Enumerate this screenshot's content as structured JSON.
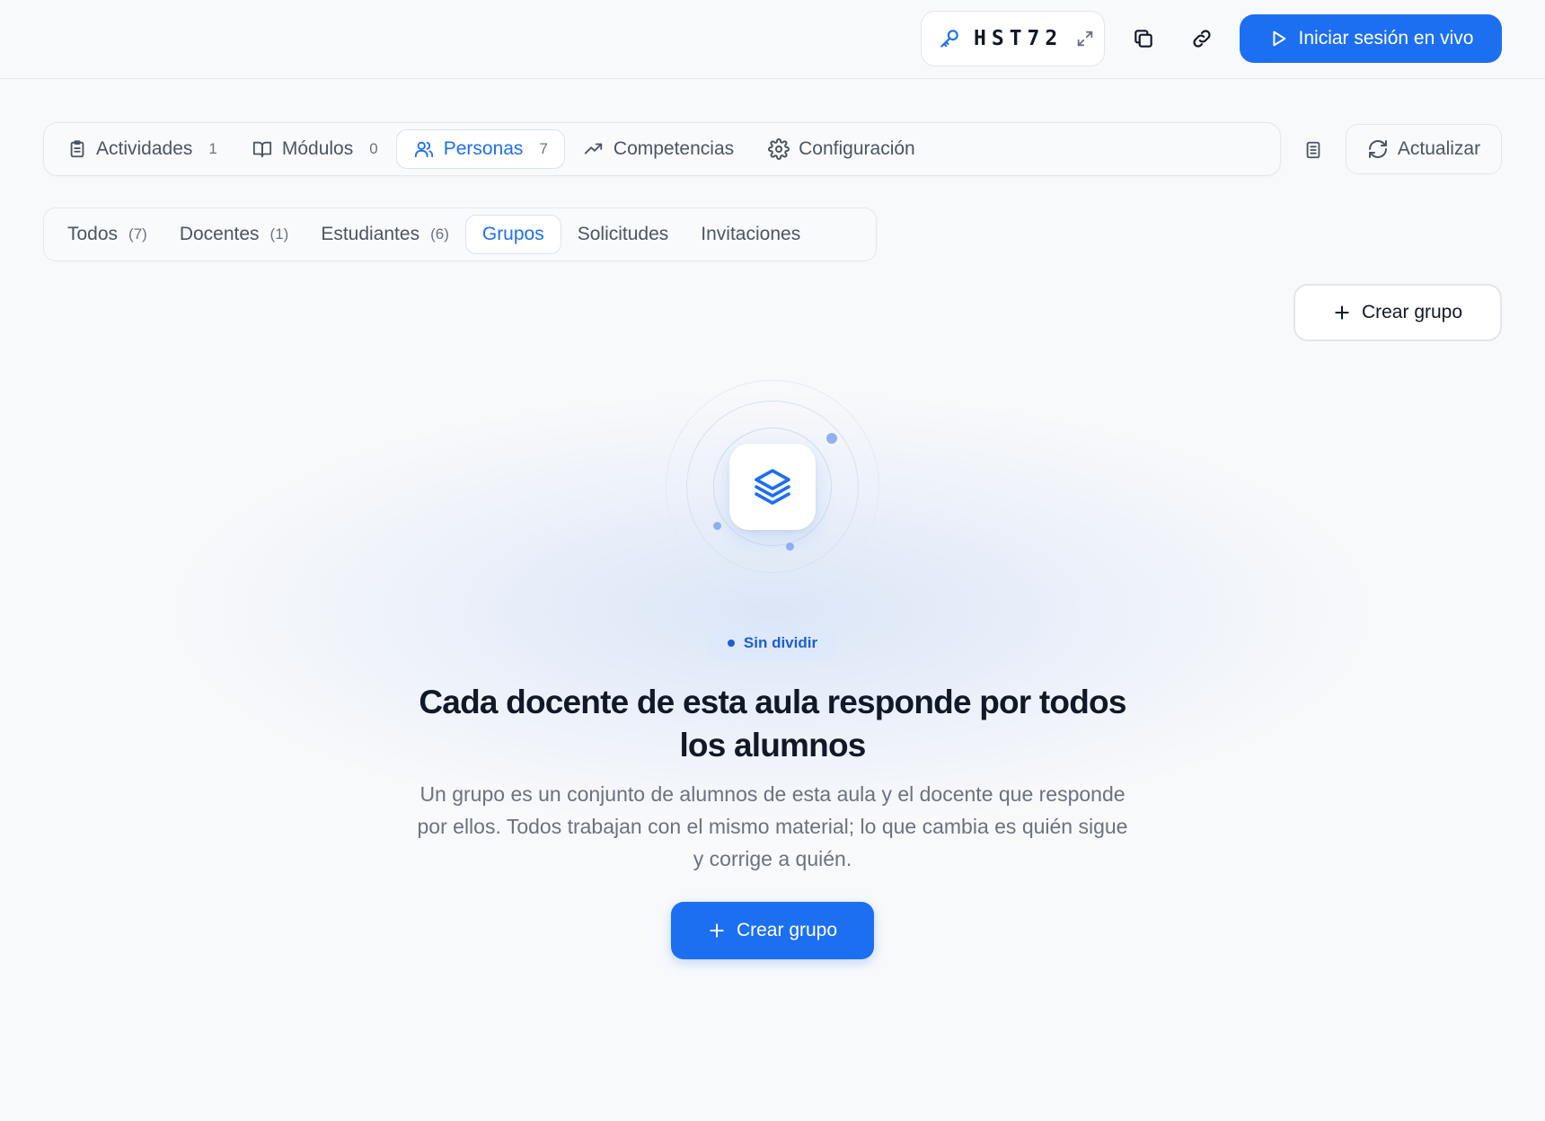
{
  "colors": {
    "accent": "#1d6ff2",
    "badge_bg": "#dde8fb",
    "text_muted": "#6b7280"
  },
  "topbar": {
    "code_icon": "key-icon",
    "class_code": "HST72",
    "expand_icon": "expand-arrows-icon",
    "copy_icon": "copy-icon",
    "link_icon": "link-icon",
    "live_icon": "play-icon",
    "live_label": "Iniciar sesión en vivo"
  },
  "main_tabs": [
    {
      "icon": "clipboard-icon",
      "label": "Actividades",
      "count": "1",
      "active": false
    },
    {
      "icon": "book-open-icon",
      "label": "Módulos",
      "count": "0",
      "active": false
    },
    {
      "icon": "users-icon",
      "label": "Personas",
      "count": "7",
      "active": true
    },
    {
      "icon": "trending-up-icon",
      "label": "Competencias",
      "count": "",
      "active": false
    },
    {
      "icon": "gear-icon",
      "label": "Configuración",
      "count": "",
      "active": false
    }
  ],
  "toolbar": {
    "doc_icon": "document-icon",
    "refresh_icon": "refresh-icon",
    "refresh_label": "Actualizar"
  },
  "sub_tabs": [
    {
      "label": "Todos",
      "count": "(7)",
      "active": false
    },
    {
      "label": "Docentes",
      "count": "(1)",
      "active": false
    },
    {
      "label": "Estudiantes",
      "count": "(6)",
      "active": false
    },
    {
      "label": "Grupos",
      "count": "",
      "active": true
    },
    {
      "label": "Solicitudes",
      "count": "",
      "active": false
    },
    {
      "label": "Invitaciones",
      "count": "",
      "active": false
    }
  ],
  "create_group_top": {
    "icon": "plus-icon",
    "label": "Crear grupo"
  },
  "empty_state": {
    "icon": "layers-icon",
    "badge": "Sin dividir",
    "headline": "Cada docente de esta aula responde por todos los alumnos",
    "description": "Un grupo es un conjunto de alumnos de esta aula y el docente que responde por ellos. Todos trabajan con el mismo material; lo que cambia es quién sigue y corrige a quién.",
    "button_icon": "plus-icon",
    "button_label": "Crear grupo"
  }
}
